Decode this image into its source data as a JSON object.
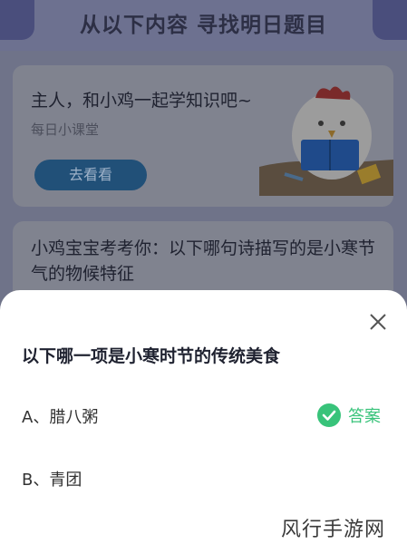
{
  "banner": {
    "title": "从以下内容 寻找明日题目"
  },
  "card1": {
    "title": "主人，和小鸡一起学知识吧~",
    "subtitle": "每日小课堂",
    "button_label": "去看看"
  },
  "card2": {
    "question": "小鸡宝宝考考你：以下哪句诗描写的是小寒节气的物候特征"
  },
  "sheet": {
    "title": "以下哪一项是小寒时节的传统美食",
    "options": [
      {
        "label": "A、腊八粥",
        "is_answer": true
      },
      {
        "label": "B、青团",
        "is_answer": false
      }
    ],
    "answer_label": "答案",
    "answer_color": "#38c37a",
    "close_icon": "close-icon"
  },
  "watermark": "风行手游网"
}
